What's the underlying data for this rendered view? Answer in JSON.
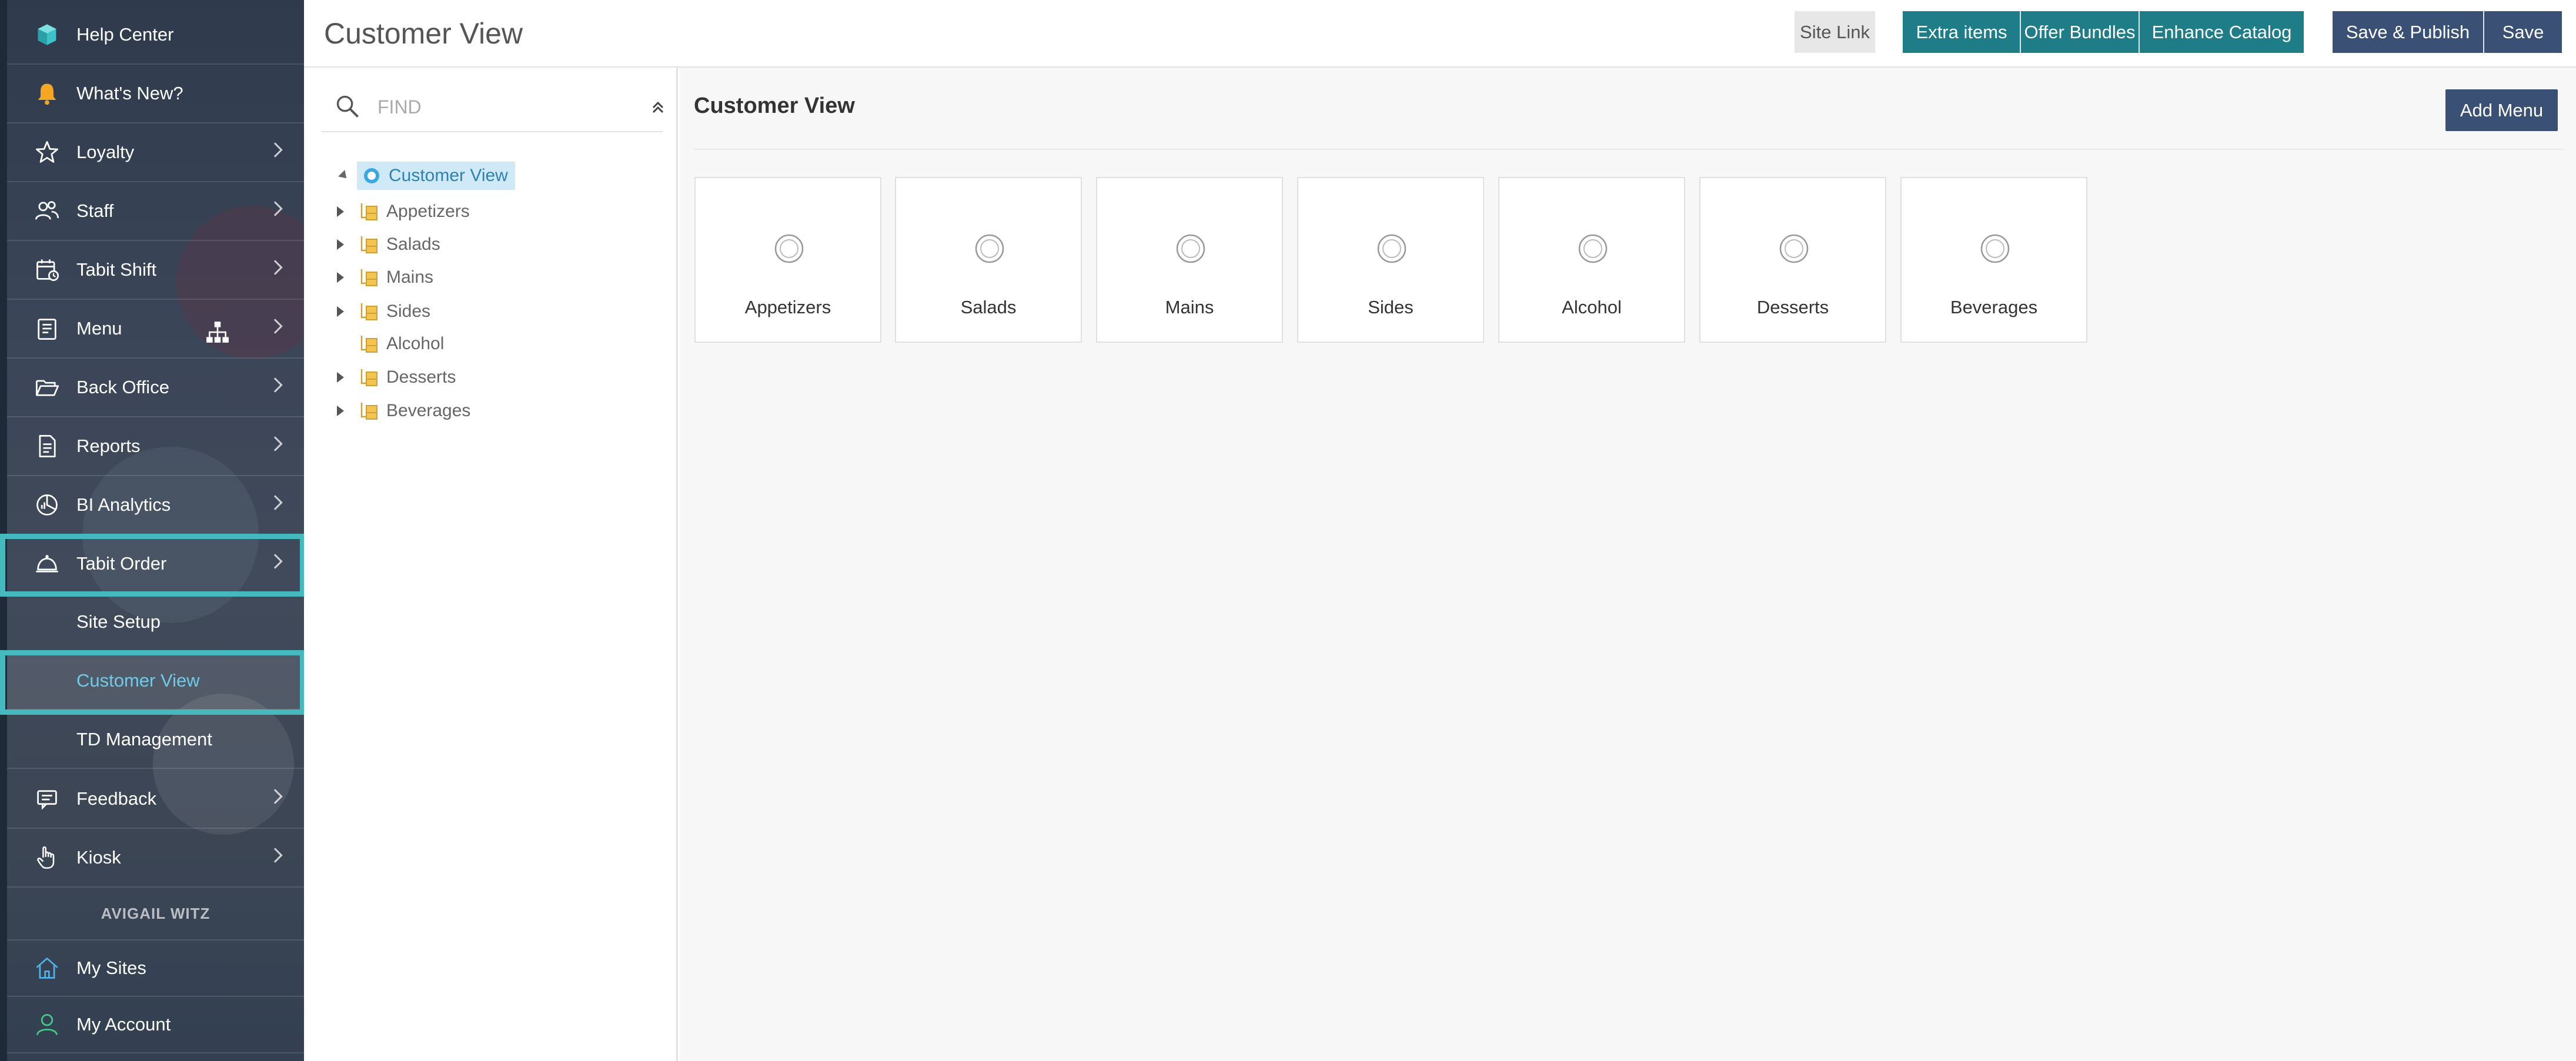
{
  "sidebar": {
    "items": [
      {
        "label": "Help Center",
        "icon": "help-center-icon",
        "chevron": false
      },
      {
        "label": "What's New?",
        "icon": "bell-icon",
        "chevron": false
      },
      {
        "label": "Loyalty",
        "icon": "star-icon",
        "chevron": true
      },
      {
        "label": "Staff",
        "icon": "staff-icon",
        "chevron": true
      },
      {
        "label": "Tabit Shift",
        "icon": "calendar-clock-icon",
        "chevron": true
      },
      {
        "label": "Menu",
        "icon": "menu-book-icon",
        "chevron": true
      },
      {
        "label": "Back Office",
        "icon": "folder-open-icon",
        "chevron": true
      },
      {
        "label": "Reports",
        "icon": "report-icon",
        "chevron": true
      },
      {
        "label": "BI Analytics",
        "icon": "analytics-icon",
        "chevron": true
      },
      {
        "label": "Tabit Order",
        "icon": "cloche-icon",
        "chevron": true
      }
    ],
    "sub_items": [
      {
        "label": "Site Setup"
      },
      {
        "label": "Customer View",
        "active": true
      },
      {
        "label": "TD Management"
      }
    ],
    "items_after": [
      {
        "label": "Feedback",
        "icon": "feedback-icon",
        "chevron": true
      },
      {
        "label": "Kiosk",
        "icon": "hand-pointer-icon",
        "chevron": true
      }
    ],
    "user_name": "AVIGAIL WITZ",
    "account_items": [
      {
        "label": "My Sites",
        "icon": "home-icon"
      },
      {
        "label": "My Account",
        "icon": "account-icon"
      }
    ]
  },
  "header": {
    "title": "Customer View",
    "buttons": {
      "site_link": "Site Link",
      "extra_items": "Extra items",
      "offer_bundles": "Offer Bundles",
      "enhance_catalog": "Enhance Catalog",
      "save_publish": "Save & Publish",
      "save": "Save"
    }
  },
  "tree": {
    "search_placeholder": "FIND",
    "root": "Customer View",
    "children": [
      {
        "label": "Appetizers",
        "expandable": true
      },
      {
        "label": "Salads",
        "expandable": true
      },
      {
        "label": "Mains",
        "expandable": true
      },
      {
        "label": "Sides",
        "expandable": true
      },
      {
        "label": "Alcohol",
        "expandable": false
      },
      {
        "label": "Desserts",
        "expandable": true
      },
      {
        "label": "Beverages",
        "expandable": true
      }
    ]
  },
  "main": {
    "title": "Customer View",
    "add_menu": "Add Menu",
    "cards": [
      "Appetizers",
      "Salads",
      "Mains",
      "Sides",
      "Alcohol",
      "Desserts",
      "Beverages"
    ]
  },
  "colors": {
    "teal": "#1f7d88",
    "navy": "#3a5074",
    "highlight": "#45b9bd",
    "active_link": "#6ecbe6"
  }
}
